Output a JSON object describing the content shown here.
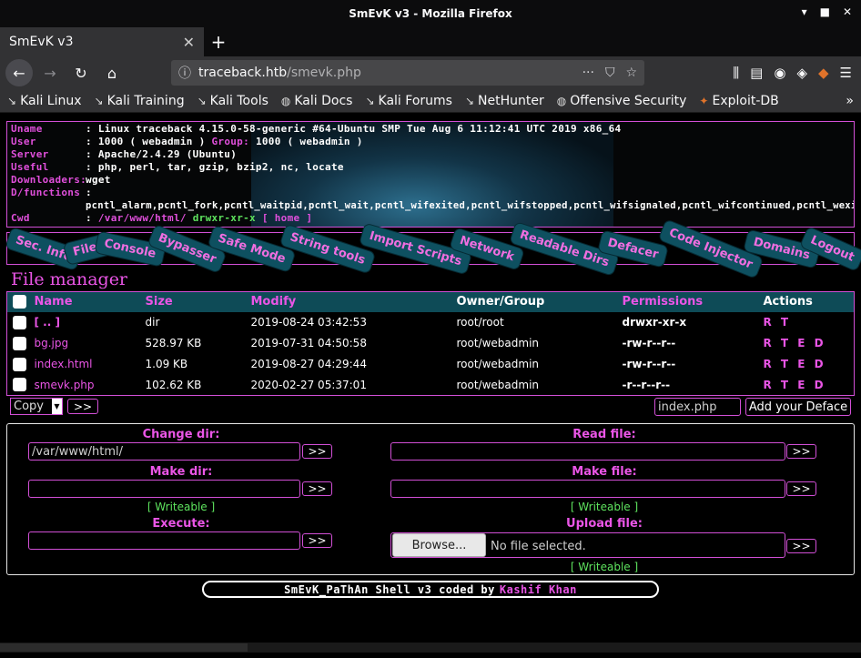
{
  "window": {
    "title": "SmEvK v3 - Mozilla Firefox",
    "controls": [
      "▾",
      "■",
      "▪",
      "✕"
    ]
  },
  "tab": {
    "title": "SmEvK v3",
    "close": "✕",
    "new": "+"
  },
  "nav": {
    "back": "←",
    "forward": "→",
    "reload": "↻",
    "home": "⌂",
    "url_host": "traceback.htb",
    "url_path": "/smevk.php",
    "url_actions": [
      "···",
      "⛉",
      "☆"
    ],
    "right_icons": [
      "⫼",
      "▤",
      "◉",
      "◈",
      "◆",
      "☰"
    ]
  },
  "bookmarks": [
    {
      "icon": "↘",
      "label": "Kali Linux"
    },
    {
      "icon": "↘",
      "label": "Kali Training"
    },
    {
      "icon": "↘",
      "label": "Kali Tools"
    },
    {
      "icon": "◍",
      "label": "Kali Docs"
    },
    {
      "icon": "↘",
      "label": "Kali Forums"
    },
    {
      "icon": "↘",
      "label": "NetHunter"
    },
    {
      "icon": "◍",
      "label": "Offensive Security"
    },
    {
      "icon": "✦",
      "label": "Exploit-DB"
    }
  ],
  "bookmarks_more": "»",
  "info": {
    "uname_k": "Uname",
    "uname_v": ": Linux traceback 4.15.0-58-generic #64-Ubuntu SMP Tue Aug 6 11:12:41 UTC 2019 x86_64",
    "user_k": "User",
    "user_v1": ": 1000 ( webadmin )",
    "user_group_k": "Group:",
    "user_v2": "1000 ( webadmin )",
    "server_k": "Server",
    "server_v": ": Apache/2.4.29 (Ubuntu)",
    "useful_k": "Useful",
    "useful_v": ": php, perl, tar, gzip, bzip2, nc, locate",
    "down_k": "Downloaders:",
    "down_v": "wget",
    "dfunc_k": "D/functions",
    "dfunc_colon": ":",
    "dfunc_v": "pcntl_alarm,pcntl_fork,pcntl_waitpid,pcntl_wait,pcntl_wifexited,pcntl_wifstopped,pcntl_wifsignaled,pcntl_wifcontinued,pcntl_wexitstatus",
    "cwd_k": "Cwd",
    "cwd_colon": ":",
    "cwd_path": "/var/www/html/",
    "cwd_perm": "drwxr-xr-x",
    "cwd_home": "[ home ]"
  },
  "menu": [
    "Sec. Info",
    "Files",
    "Console",
    "Bypasser",
    "Safe Mode",
    "String tools",
    "Import Scripts",
    "Network",
    "Readable Dirs",
    "Defacer",
    "Code Injector",
    "Domains",
    "Logout"
  ],
  "filemanager": {
    "title": "File manager",
    "headers": {
      "name": "Name",
      "size": "Size",
      "modify": "Modify",
      "owner": "Owner/Group",
      "perms": "Permissions",
      "actions": "Actions"
    },
    "rows": [
      {
        "name": "[ .. ]",
        "size": "dir",
        "modify": "2019-08-24 03:42:53",
        "owner": "root/root",
        "perms": "drwxr-xr-x",
        "actions": "R T",
        "bold": true
      },
      {
        "name": "bg.jpg",
        "size": "528.97 KB",
        "modify": "2019-07-31 04:50:58",
        "owner": "root/webadmin",
        "perms": "-rw-r--r--",
        "actions": "R T E D",
        "bold": false
      },
      {
        "name": "index.html",
        "size": "1.09 KB",
        "modify": "2019-08-27 04:29:44",
        "owner": "root/webadmin",
        "perms": "-rw-r--r--",
        "actions": "R T E D",
        "bold": false
      },
      {
        "name": "smevk.php",
        "size": "102.62 KB",
        "modify": "2020-02-27 05:37:01",
        "owner": "root/webadmin",
        "perms": "-r--r--r--",
        "actions": "R T E D",
        "bold": false
      }
    ],
    "copy_select": "Copy",
    "go_btn": ">>",
    "deface_file": "index.php",
    "deface_btn": "Add your Deface"
  },
  "tools": {
    "change_dir": "Change dir:",
    "change_dir_value": "/var/www/html/",
    "read_file": "Read file:",
    "make_dir": "Make dir:",
    "make_file": "Make file:",
    "writeable": "[ Writeable ]",
    "execute": "Execute:",
    "upload_file": "Upload file:",
    "browse": "Browse...",
    "no_file": "No file selected.",
    "go": ">>"
  },
  "footer": {
    "text": "SmEvK_PaThAn Shell v3 coded by",
    "author": "Kashif Khan"
  }
}
